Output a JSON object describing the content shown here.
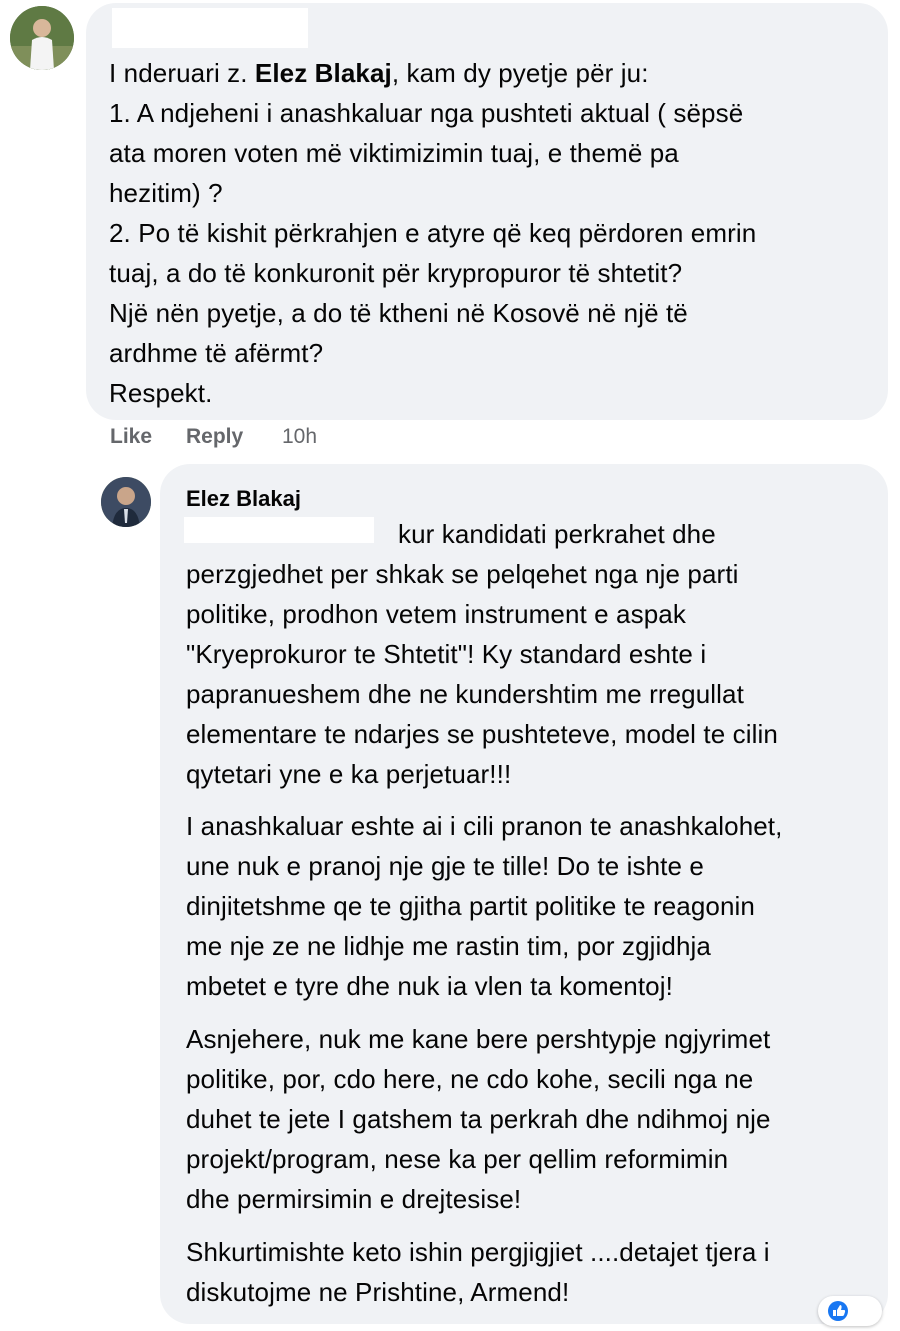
{
  "comment": {
    "intro_prefix": "I nderuari z. ",
    "intro_name": "Elez Blakaj",
    "intro_suffix": ", kam dy pyetje për ju:",
    "lines": [
      "1. A ndjeheni i anashkaluar nga pushteti aktual ( sëpsë",
      "ata moren voten më viktimizimin tuaj, e themë pa",
      "hezitim) ?",
      "2. Po të kishit përkrahjen e atyre që keq përdoren emrin",
      "tuaj, a do të konkuronit për krypropuror të shtetit?",
      "Një nën pyetje, a do të ktheni në Kosovë në një të",
      "ardhme të afërmt?",
      "Respekt."
    ],
    "actions": {
      "like": "Like",
      "reply": "Reply",
      "time": "10h"
    }
  },
  "reply": {
    "author": "Elez Blakaj",
    "paragraph1": [
      "kur kandidati perkrahet dhe",
      "perzgjedhet per shkak se pelqehet nga nje parti",
      "politike, prodhon vetem instrument e aspak",
      "\"Kryeprokuror te Shtetit\"! Ky standard eshte i",
      "papranueshem dhe ne kundershtim me rregullat",
      "elementare te ndarjes se pushteteve, model te cilin",
      "qytetari yne e ka perjetuar!!!"
    ],
    "paragraph2": [
      "I anashkaluar eshte ai i cili pranon te anashkalohet,",
      "une nuk e pranoj nje gje te tille! Do te ishte e",
      "dinjitetshme qe te gjitha partit politike te reagonin",
      "me nje ze ne lidhje me rastin tim, por zgjidhja",
      "mbetet e tyre dhe nuk ia vlen ta komentoj!"
    ],
    "paragraph3": [
      "Asnjehere, nuk me kane bere pershtypje ngjyrimet",
      "politike, por, cdo here, ne cdo kohe, secili nga ne",
      "duhet te jete I gatshem ta perkrah dhe ndihmoj nje",
      "projekt/program, nese ka per qellim reformimin",
      "dhe permirsimin e drejtesise!"
    ],
    "paragraph4": [
      "Shkurtimishte keto ishin pergjigjiet ....detajet tjera i",
      "diskutojme ne Prishtine, Armend!"
    ]
  }
}
